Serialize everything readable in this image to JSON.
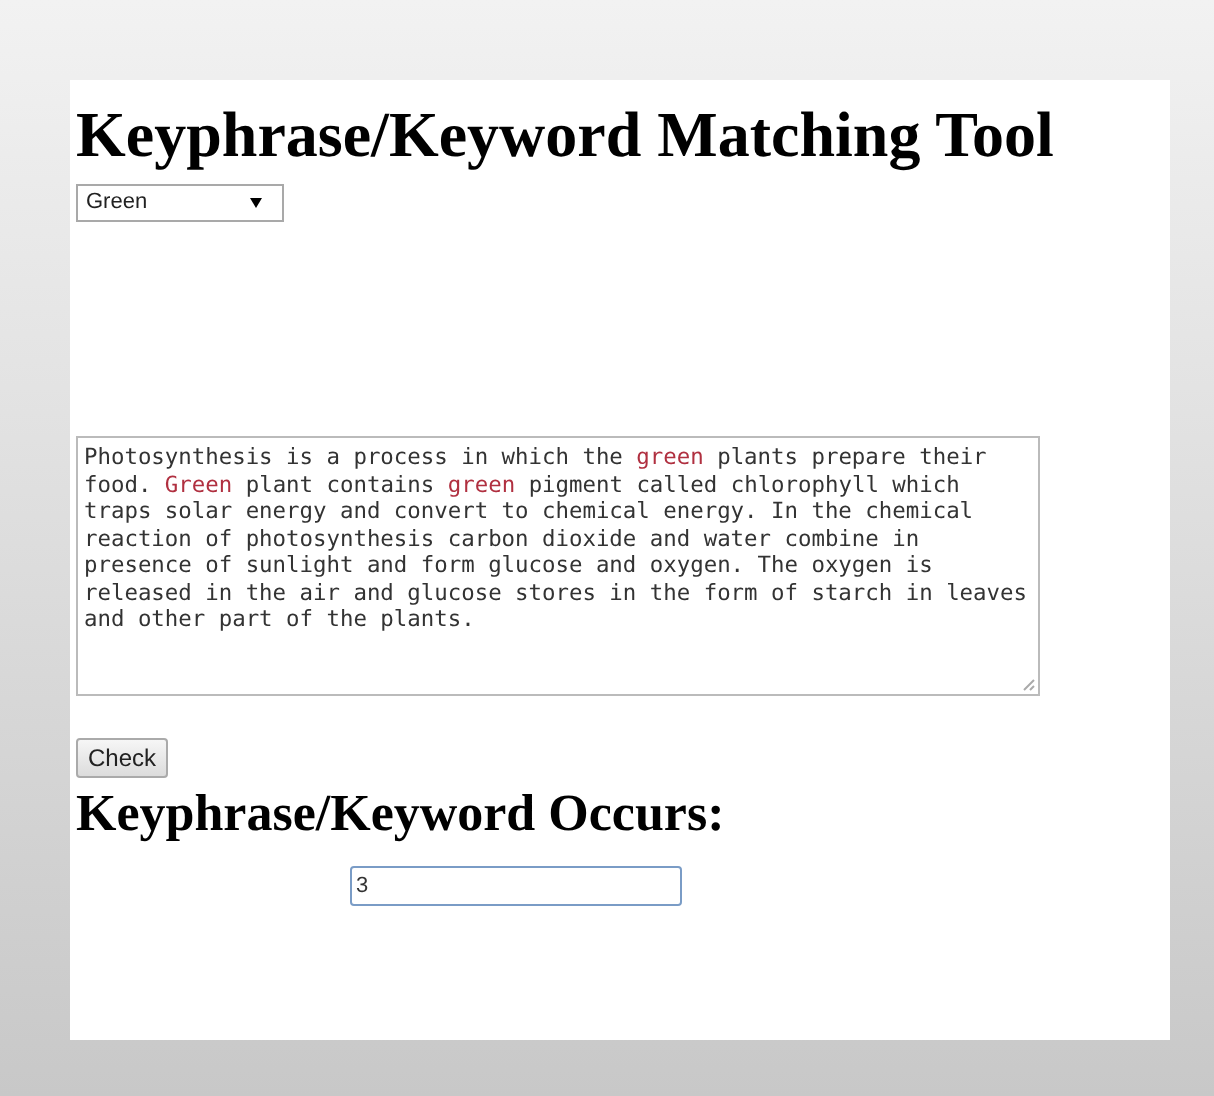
{
  "title": "Keyphrase/Keyword Matching Tool",
  "keyword_select": {
    "value": "Green"
  },
  "text_area": {
    "segments": [
      {
        "text": "Photosynthesis is a process in which the ",
        "highlighted": false
      },
      {
        "text": "green",
        "highlighted": true
      },
      {
        "text": " plants prepare their food. ",
        "highlighted": false
      },
      {
        "text": "Green",
        "highlighted": true
      },
      {
        "text": " plant contains ",
        "highlighted": false
      },
      {
        "text": "green",
        "highlighted": true
      },
      {
        "text": " pigment called chlorophyll which traps solar energy and convert to chemical energy. In the chemical reaction of photosynthesis carbon dioxide and water combine in presence of sunlight and form glucose and oxygen. The oxygen is released in the air and glucose stores in the form of starch in leaves and other part of the plants.",
        "highlighted": false
      }
    ]
  },
  "check_button": "Check",
  "result_heading": "Keyphrase/Keyword Occurs:",
  "result_field": {
    "value": "3"
  }
}
